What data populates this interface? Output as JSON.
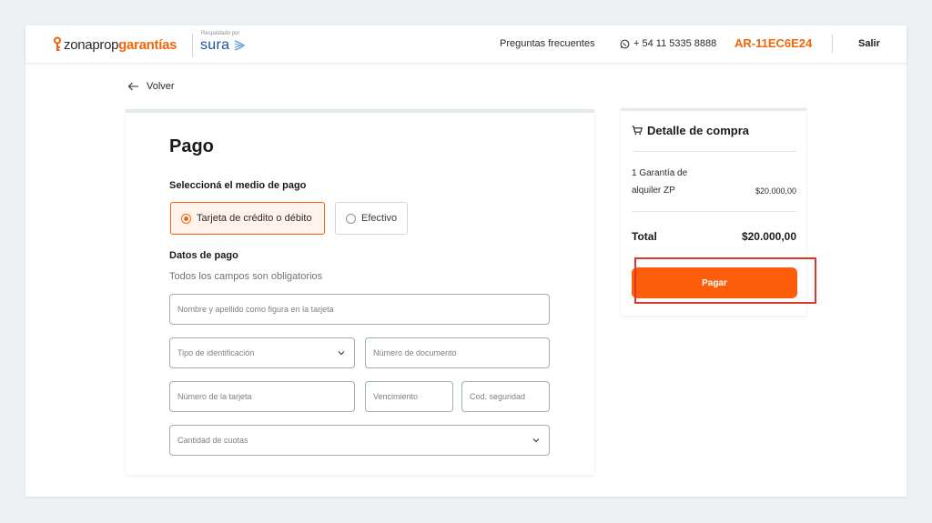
{
  "header": {
    "logo_part1": "zonaprop",
    "logo_part2": "garantías",
    "partner_caption": "Respaldado por",
    "partner_name": "sura",
    "faq_label": "Preguntas frecuentes",
    "phone": "+ 54 11 5335 8888",
    "reference_code": "AR-11EC6E24",
    "exit_label": "Salir"
  },
  "back_label": "Volver",
  "payment": {
    "title": "Pago",
    "method_label": "Seleccioná el medio de pago",
    "methods": [
      {
        "label": "Tarjeta de crédito o débito",
        "selected": true
      },
      {
        "label": "Efectivo",
        "selected": false
      }
    ],
    "details_label": "Datos de pago",
    "required_hint": "Todos los campos son obligatorios",
    "fields": {
      "cardholder_placeholder": "Nombre y apellido como figura en la tarjeta",
      "id_type_placeholder": "Tipo de identificación",
      "document_placeholder": "Número de documento",
      "card_number_placeholder": "Número de la tarjeta",
      "expiry_placeholder": "Vencimiento",
      "cvv_placeholder": "Cod. seguridad",
      "installments_placeholder": "Cantidad de cuotas"
    }
  },
  "summary": {
    "title": "Detalle de compra",
    "item_name": "1 Garantía de alquiler ZP",
    "item_price": "$20.000,00",
    "total_label": "Total",
    "total_value": "$20.000,00",
    "pay_label": "Pagar"
  },
  "colors": {
    "accent": "#f2650a",
    "button": "#fd5e0c",
    "highlight": "#d93a2b",
    "partner": "#1d4fa0"
  }
}
